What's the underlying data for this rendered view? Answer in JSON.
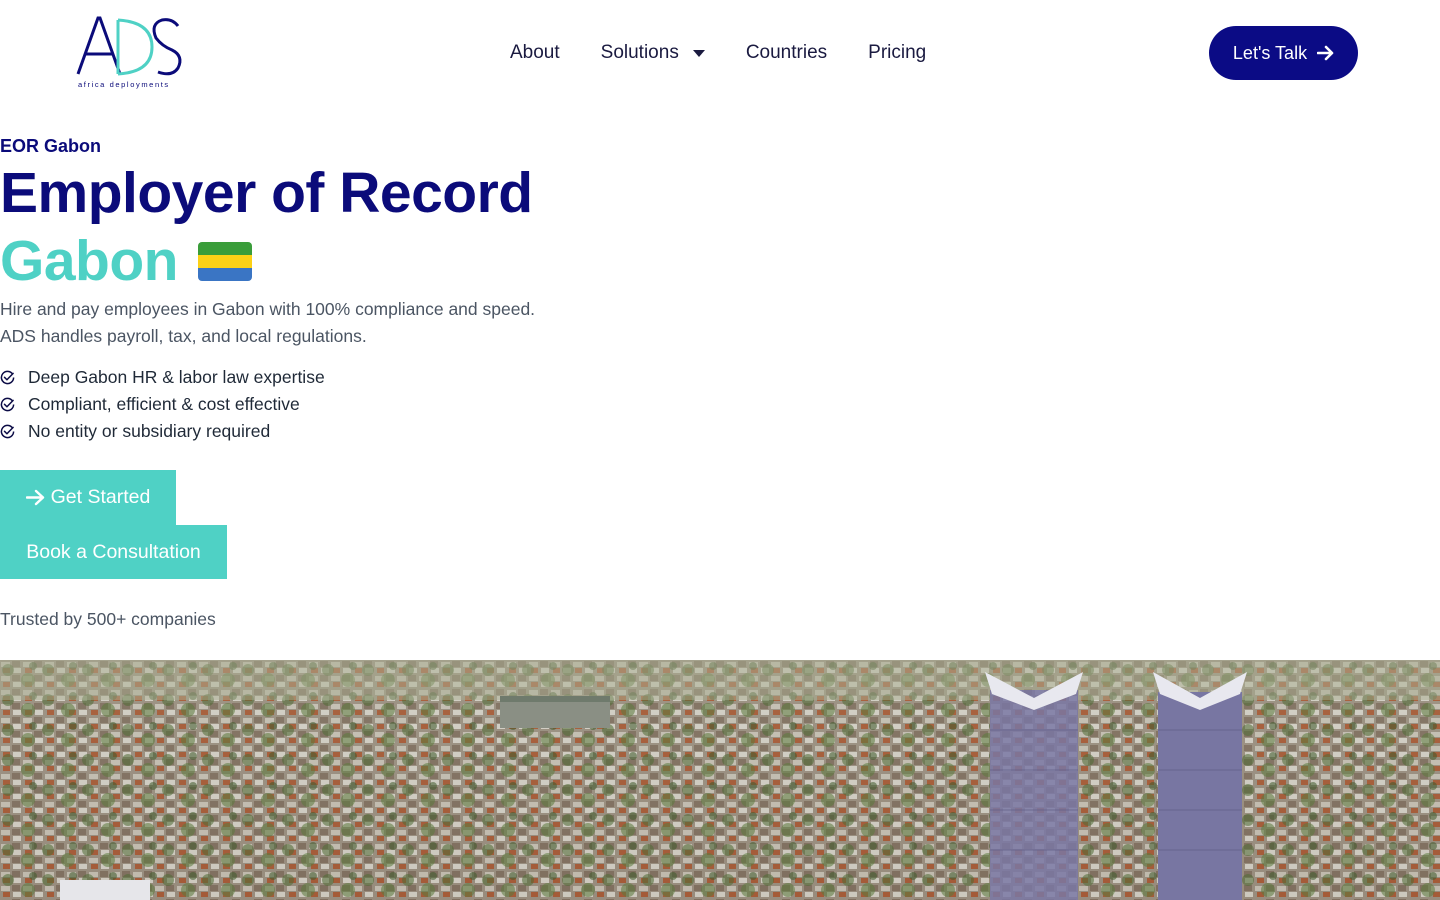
{
  "header": {
    "logo_text": "ADS",
    "logo_tagline": "africa deployments",
    "nav": [
      {
        "label": "About"
      },
      {
        "label": "Solutions",
        "has_dropdown": true
      },
      {
        "label": "Countries"
      },
      {
        "label": "Pricing"
      }
    ],
    "cta_label": "Let's Talk"
  },
  "hero": {
    "eyebrow": "EOR Gabon",
    "title_line1": "Employer of Record",
    "title_line2": "Gabon",
    "description_line1": "Hire and pay employees in Gabon with 100% compliance and speed.",
    "description_line2": "ADS handles payroll, tax, and local regulations.",
    "features": [
      "Deep Gabon HR & labor law expertise",
      "Compliant, efficient & cost effective",
      "No entity or subsidiary required"
    ],
    "primary_button": "Get Started",
    "secondary_button": "Book a Consultation",
    "trusted_text": "Trusted by 500+ companies"
  },
  "colors": {
    "navy": "#0b0b85",
    "teal": "#4fd1c5",
    "flag_green": "#3a9d3a",
    "flag_yellow": "#fcd116",
    "flag_blue": "#3a75c4"
  },
  "icons": {
    "nav_dropdown": "chevron-down-icon",
    "cta": "arrow-right-icon",
    "feature": "check-circle-icon",
    "flag": "gabon-flag-icon"
  }
}
